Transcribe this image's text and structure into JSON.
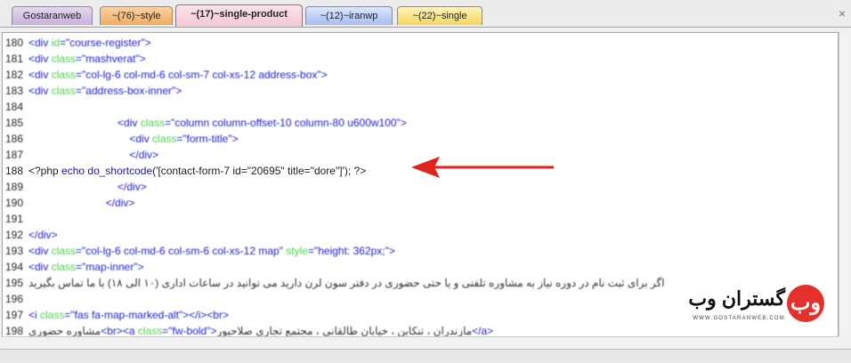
{
  "tabs": [
    {
      "label": "Gostaranweb"
    },
    {
      "label": "~(76)~style"
    },
    {
      "label": "~(17)~single-product"
    },
    {
      "label": "~(12)~iranwp"
    },
    {
      "label": "~(22)~single"
    }
  ],
  "close_glyph": "×",
  "lines": [
    {
      "n": "180",
      "parts": [
        [
          "tag",
          "<div "
        ],
        [
          "an",
          "id"
        ],
        [
          "av",
          "=\"course-register\">"
        ]
      ]
    },
    {
      "n": "181",
      "parts": [
        [
          "tag",
          "<div "
        ],
        [
          "an",
          "class"
        ],
        [
          "av",
          "=\"mashverat\">"
        ]
      ]
    },
    {
      "n": "182",
      "parts": [
        [
          "tag",
          "<div "
        ],
        [
          "an",
          "class"
        ],
        [
          "av",
          "=\"col-lg-6 col-md-6 col-sm-7 col-xs-12 address-box\">"
        ]
      ]
    },
    {
      "n": "183",
      "parts": [
        [
          "tag",
          "<div "
        ],
        [
          "an",
          "class"
        ],
        [
          "av",
          "=\"address-box-inner\">"
        ]
      ]
    },
    {
      "n": "184",
      "parts": []
    },
    {
      "n": "185",
      "parts": [
        [
          "sp",
          "                              "
        ],
        [
          "tag",
          "<div "
        ],
        [
          "an",
          "class"
        ],
        [
          "av",
          "=\"column column-offset-10 column-80 u600w100\">"
        ]
      ]
    },
    {
      "n": "186",
      "parts": [
        [
          "sp",
          "                                  "
        ],
        [
          "tag",
          "<div "
        ],
        [
          "an",
          "class"
        ],
        [
          "av",
          "=\"form-title\">"
        ]
      ]
    },
    {
      "n": "187",
      "parts": [
        [
          "sp",
          "                                  "
        ],
        [
          "tag",
          "</div>"
        ]
      ]
    },
    {
      "n": "188",
      "parts": [
        [
          "php",
          "<?php "
        ],
        [
          "php-kw",
          "echo do_shortcode"
        ],
        [
          "php",
          "('[contact-form-7 id=\"20695\" title=\"dore\"]'); ?>"
        ]
      ]
    },
    {
      "n": "189",
      "parts": [
        [
          "sp",
          "                              "
        ],
        [
          "tag",
          "</div>"
        ]
      ]
    },
    {
      "n": "190",
      "parts": [
        [
          "sp",
          "                          "
        ],
        [
          "tag",
          "</div>"
        ]
      ]
    },
    {
      "n": "191",
      "parts": []
    },
    {
      "n": "192",
      "parts": [
        [
          "tag",
          "</div>"
        ]
      ]
    },
    {
      "n": "193",
      "parts": [
        [
          "tag",
          "<div "
        ],
        [
          "an",
          "class"
        ],
        [
          "av",
          "=\"col-lg-6 col-md-6 col-sm-6 col-xs-12 map\" "
        ],
        [
          "an",
          "style"
        ],
        [
          "av",
          "=\"height: 362px;\">"
        ]
      ]
    },
    {
      "n": "194",
      "parts": [
        [
          "tag",
          "<div "
        ],
        [
          "an",
          "class"
        ],
        [
          "av",
          "=\"map-inner\">"
        ]
      ]
    },
    {
      "n": "195",
      "parts": [
        [
          "txt",
          "اگر برای ثبت نام در دوره نیاز به مشاوره تلفنی و یا حتی حضوری در دفتر سون لرن دارید می توانید در ساعات اداری (۱۰ الی ۱۸) با ما تماس بگیرید"
        ]
      ]
    },
    {
      "n": "196",
      "parts": []
    },
    {
      "n": "197",
      "parts": [
        [
          "tag",
          "<i "
        ],
        [
          "an",
          "class"
        ],
        [
          "av",
          "=\"fas fa-map-marked-alt\"></i><br>"
        ]
      ]
    },
    {
      "n": "198",
      "parts": [
        [
          "txt",
          "مشاوره حضوری"
        ],
        [
          "tag",
          "<br><a "
        ],
        [
          "an",
          "class"
        ],
        [
          "av",
          "=\"fw-bold\">"
        ],
        [
          "txt",
          "مازندران ، تنکابن ، خیابان طالقانی ، مجتمع تجاری صلاحیور"
        ],
        [
          "tag",
          "</a>"
        ]
      ]
    }
  ],
  "logo": {
    "name": "گستران وب",
    "sub": "WWW.GOSTARANWEB.COM",
    "mark": "وب"
  },
  "colors": {
    "arrow": "#e0241c",
    "tag": "#2020d0",
    "attr": "#4fcf4f"
  }
}
